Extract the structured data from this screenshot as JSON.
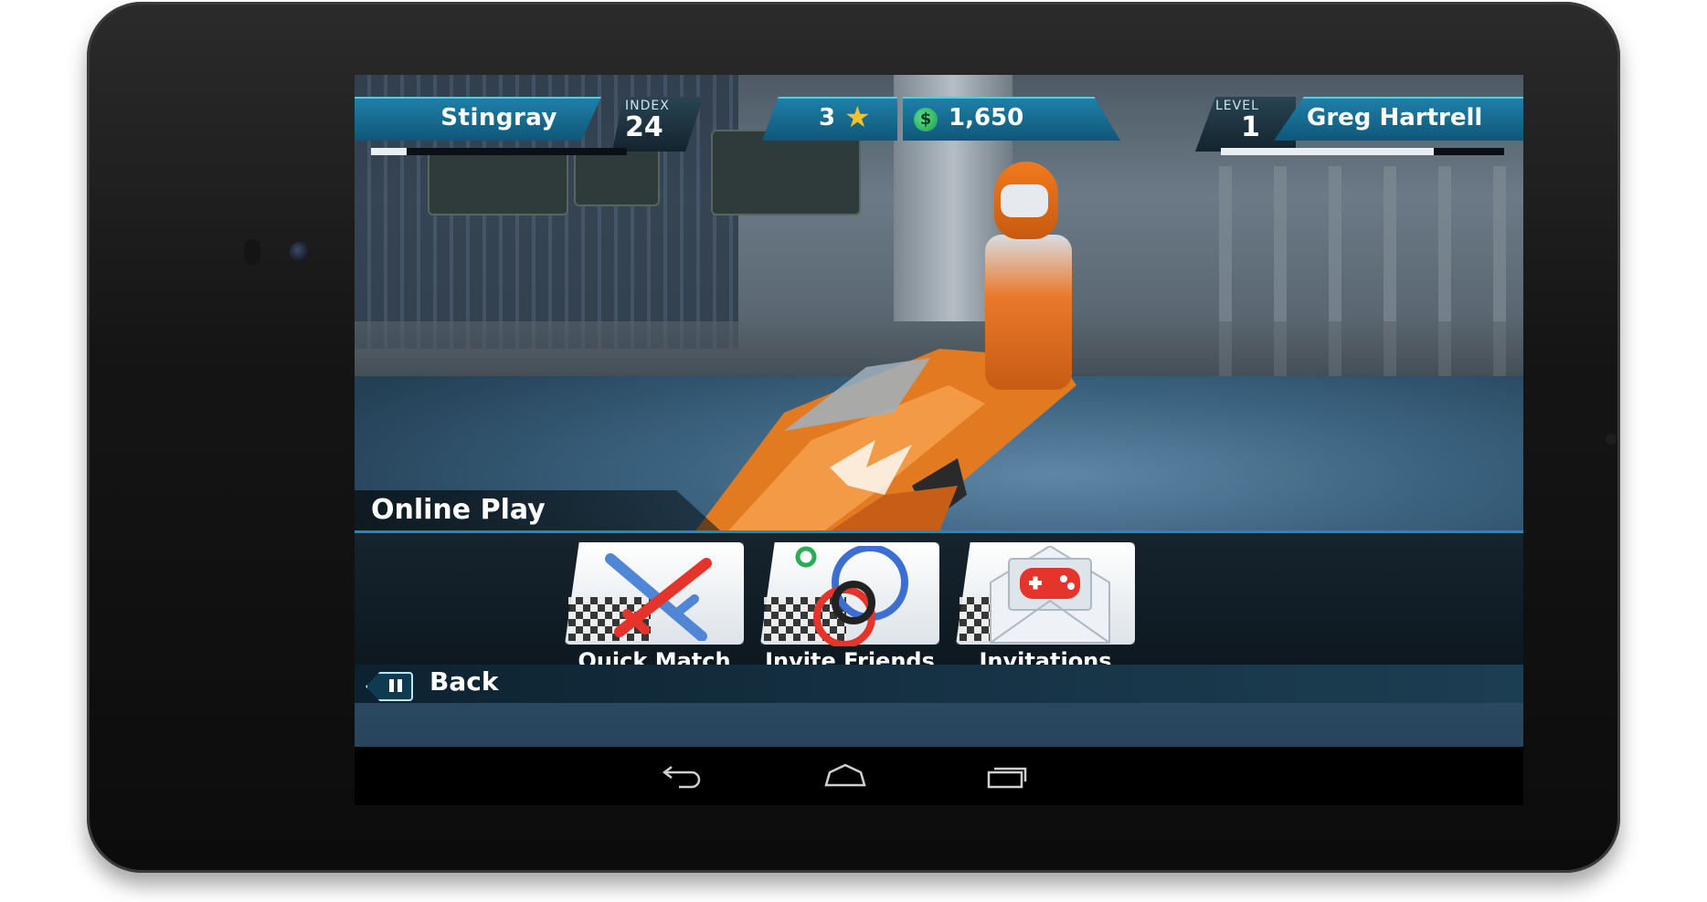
{
  "hud": {
    "vehicle_name": "Stingray",
    "index_label": "INDEX",
    "index_value": "24",
    "vehicle_progress": 0.14,
    "stars": "3",
    "cash": "1,650",
    "level_label": "LEVEL",
    "level_value": "1",
    "player_name": "Greg Hartrell",
    "xp_progress": 0.75
  },
  "section_title": "Online Play",
  "menu": [
    {
      "label": "Quick Match",
      "icon": "crossed-swords-icon"
    },
    {
      "label": "Invite Friends",
      "icon": "circles-icon"
    },
    {
      "label": "Invitations",
      "icon": "envelope-gamepad-icon"
    }
  ],
  "back_label": "Back",
  "colors": {
    "hud_blue": "#1f7fa8",
    "accent_border": "#1b8cbd",
    "star": "#f2c12e",
    "coin": "#1b9e4a",
    "sword_red": "#e5342b",
    "sword_blue": "#4f86d6"
  },
  "navbar": [
    "back-icon",
    "home-icon",
    "recent-apps-icon"
  ]
}
